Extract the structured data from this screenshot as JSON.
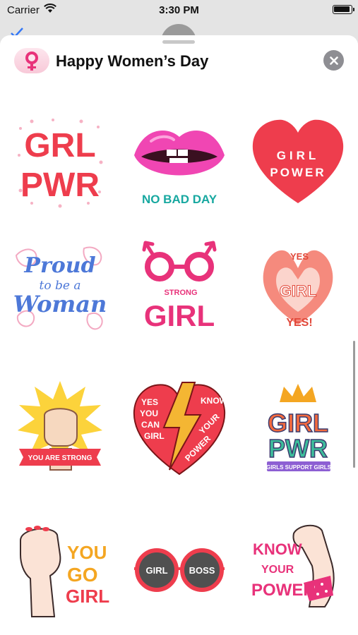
{
  "status": {
    "carrier": "Carrier",
    "time": "3:30 PM"
  },
  "header": {
    "title": "Happy Women’s Day"
  },
  "stickers": [
    {
      "name": "grl-pwr",
      "lines": [
        "GRL",
        "PWR"
      ]
    },
    {
      "name": "no-bad-day-lips",
      "lines": [
        "NO BAD DAY"
      ]
    },
    {
      "name": "girl-power-heart",
      "lines": [
        "GIRL",
        "POWER"
      ]
    },
    {
      "name": "proud-woman",
      "lines": [
        "Proud",
        "to be a",
        "Woman"
      ]
    },
    {
      "name": "strong-girl",
      "lines": [
        "STRONG",
        "GIRL"
      ]
    },
    {
      "name": "yes-girl-hands",
      "lines": [
        "YES",
        "GIRL",
        "YES!"
      ]
    },
    {
      "name": "you-are-strong-fist",
      "lines": [
        "YOU ARE STRONG"
      ]
    },
    {
      "name": "know-your-power-heart",
      "lines": [
        "YES",
        "YOU",
        "CAN",
        "GIRL",
        "KNOW",
        "YOUR",
        "POWER"
      ]
    },
    {
      "name": "girl-pwr-crown",
      "lines": [
        "GIRL",
        "PWR",
        "GIRLS SUPPORT GIRLS"
      ]
    },
    {
      "name": "you-go-girl",
      "lines": [
        "YOU",
        "GO",
        "GIRL"
      ]
    },
    {
      "name": "girl-boss-glasses",
      "lines": [
        "GIRL",
        "BOSS"
      ]
    },
    {
      "name": "know-your-power-arm",
      "lines": [
        "KNOW",
        "YOUR",
        "POWER"
      ]
    }
  ],
  "colors": {
    "accent_red": "#ee3d4d",
    "accent_pink": "#e8327a",
    "teal": "#17a8a0",
    "orange": "#f4a622"
  }
}
